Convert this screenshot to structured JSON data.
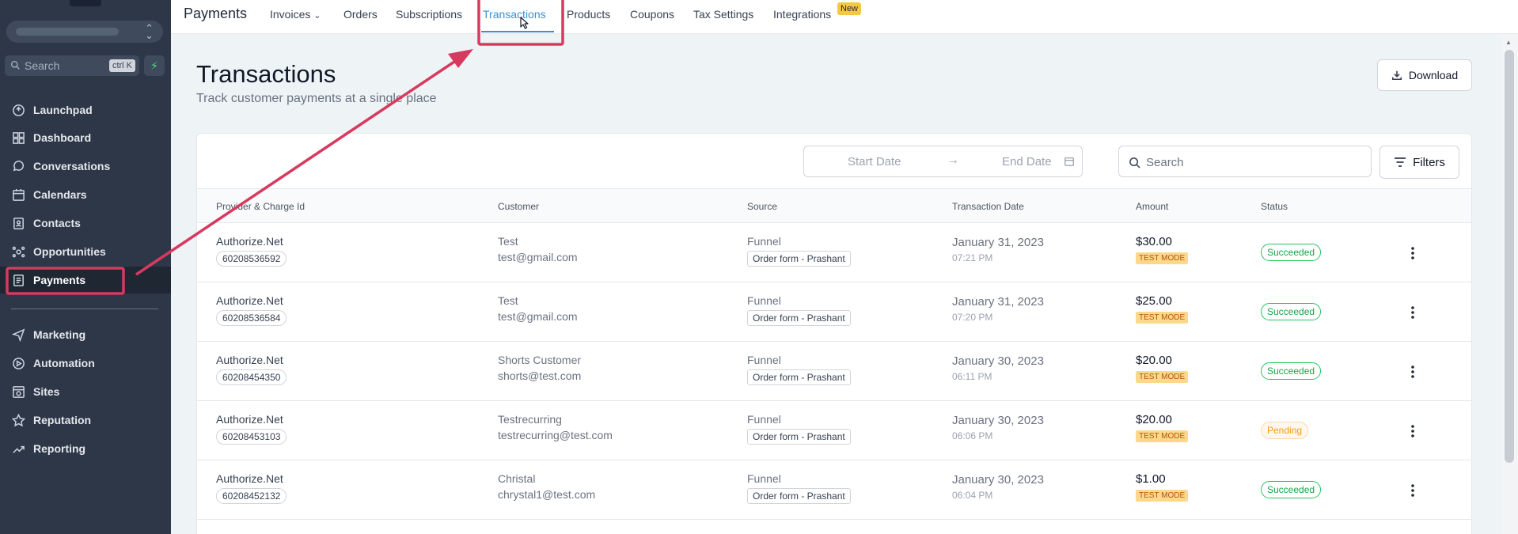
{
  "colors": {
    "sidebar_bg": "#2d3748",
    "accent": "#3b8fd6",
    "annotation": "#d63a5e",
    "success": "#16a34a",
    "pending": "#f59e0b",
    "test_mode_bg": "#fcd98a"
  },
  "sidebar": {
    "search_placeholder": "Search",
    "search_shortcut": "ctrl K",
    "items": [
      {
        "label": "Launchpad",
        "icon": "launchpad-icon"
      },
      {
        "label": "Dashboard",
        "icon": "dashboard-icon"
      },
      {
        "label": "Conversations",
        "icon": "chat-bubble-icon"
      },
      {
        "label": "Calendars",
        "icon": "calendar-icon"
      },
      {
        "label": "Contacts",
        "icon": "contacts-icon"
      },
      {
        "label": "Opportunities",
        "icon": "opportunities-icon"
      },
      {
        "label": "Payments",
        "icon": "payments-icon",
        "active": true
      },
      {
        "label": "Marketing",
        "icon": "paper-plane-icon"
      },
      {
        "label": "Automation",
        "icon": "automation-icon"
      },
      {
        "label": "Sites",
        "icon": "sites-icon"
      },
      {
        "label": "Reputation",
        "icon": "star-icon"
      },
      {
        "label": "Reporting",
        "icon": "trending-up-icon"
      }
    ]
  },
  "header": {
    "title": "Payments",
    "tabs": [
      {
        "label": "Invoices",
        "has_dropdown": true
      },
      {
        "label": "Orders"
      },
      {
        "label": "Subscriptions"
      },
      {
        "label": "Transactions",
        "active": true
      },
      {
        "label": "Products"
      },
      {
        "label": "Coupons"
      },
      {
        "label": "Tax Settings"
      },
      {
        "label": "Integrations",
        "badge": "New"
      }
    ]
  },
  "page": {
    "title": "Transactions",
    "subtitle": "Track customer payments at a single place",
    "download_label": "Download"
  },
  "filters": {
    "start_date_placeholder": "Start Date",
    "end_date_placeholder": "End Date",
    "search_placeholder": "Search",
    "filters_label": "Filters"
  },
  "table": {
    "columns": [
      "Provider & Charge Id",
      "Customer",
      "Source",
      "Transaction Date",
      "Amount",
      "Status"
    ],
    "rows": [
      {
        "provider": "Authorize.Net",
        "charge_id": "60208536592",
        "customer_name": "Test",
        "customer_email": "test@gmail.com",
        "source": "Funnel",
        "source_detail": "Order form - Prashant",
        "date": "January 31, 2023",
        "time": "07:21 PM",
        "amount": "$30.00",
        "mode": "TEST MODE",
        "status": "Succeeded"
      },
      {
        "provider": "Authorize.Net",
        "charge_id": "60208536584",
        "customer_name": "Test",
        "customer_email": "test@gmail.com",
        "source": "Funnel",
        "source_detail": "Order form - Prashant",
        "date": "January 31, 2023",
        "time": "07:20 PM",
        "amount": "$25.00",
        "mode": "TEST MODE",
        "status": "Succeeded"
      },
      {
        "provider": "Authorize.Net",
        "charge_id": "60208454350",
        "customer_name": "Shorts Customer",
        "customer_email": "shorts@test.com",
        "source": "Funnel",
        "source_detail": "Order form - Prashant",
        "date": "January 30, 2023",
        "time": "06:11 PM",
        "amount": "$20.00",
        "mode": "TEST MODE",
        "status": "Succeeded"
      },
      {
        "provider": "Authorize.Net",
        "charge_id": "60208453103",
        "customer_name": "Testrecurring",
        "customer_email": "testrecurring@test.com",
        "source": "Funnel",
        "source_detail": "Order form - Prashant",
        "date": "January 30, 2023",
        "time": "06:06 PM",
        "amount": "$20.00",
        "mode": "TEST MODE",
        "status": "Pending"
      },
      {
        "provider": "Authorize.Net",
        "charge_id": "60208452132",
        "customer_name": "Christal",
        "customer_email": "chrystal1@test.com",
        "source": "Funnel",
        "source_detail": "Order form - Prashant",
        "date": "January 30, 2023",
        "time": "06:04 PM",
        "amount": "$1.00",
        "mode": "TEST MODE",
        "status": "Succeeded"
      }
    ]
  }
}
